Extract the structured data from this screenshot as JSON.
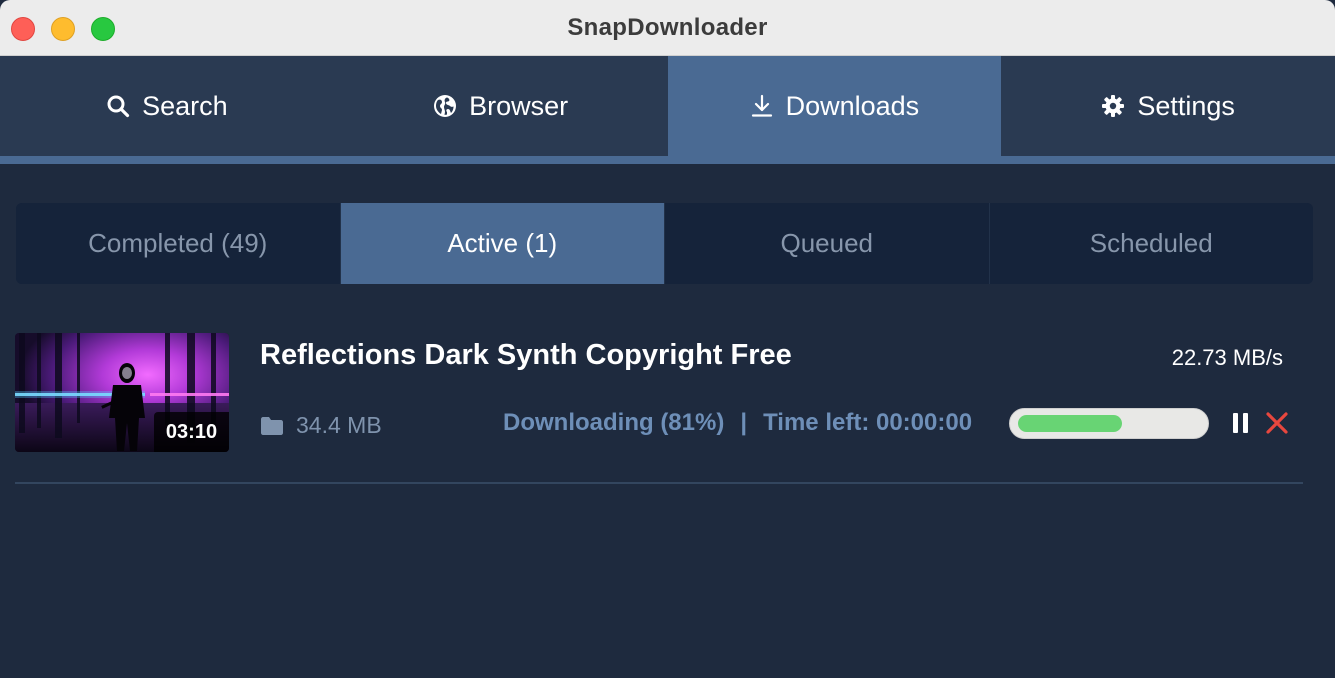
{
  "window": {
    "title": "SnapDownloader"
  },
  "nav": {
    "search_label": "Search",
    "browser_label": "Browser",
    "downloads_label": "Downloads",
    "settings_label": "Settings",
    "active": "Downloads"
  },
  "subtabs": {
    "completed": "Completed (49)",
    "active": "Active (1)",
    "queued": "Queued",
    "scheduled": "Scheduled",
    "selected": "Active (1)"
  },
  "download": {
    "title": "Reflections Dark Synth Copyright Free",
    "duration": "03:10",
    "speed": "22.73 MB/s",
    "size": "34.4 MB",
    "status": "Downloading (81%)",
    "separator": "|",
    "time_left": "Time left: 00:00:00",
    "progress_percent": 81
  },
  "icons": {
    "search": "search-icon",
    "browser": "globe-icon",
    "downloads": "download-icon",
    "settings": "gear-icon",
    "folder": "folder-icon",
    "pause": "pause-icon",
    "cancel": "close-icon"
  },
  "colors": {
    "accent": "#4a6a93",
    "progress": "#68d474",
    "cancel": "#e8473e",
    "status_text": "#6e8fb8"
  }
}
